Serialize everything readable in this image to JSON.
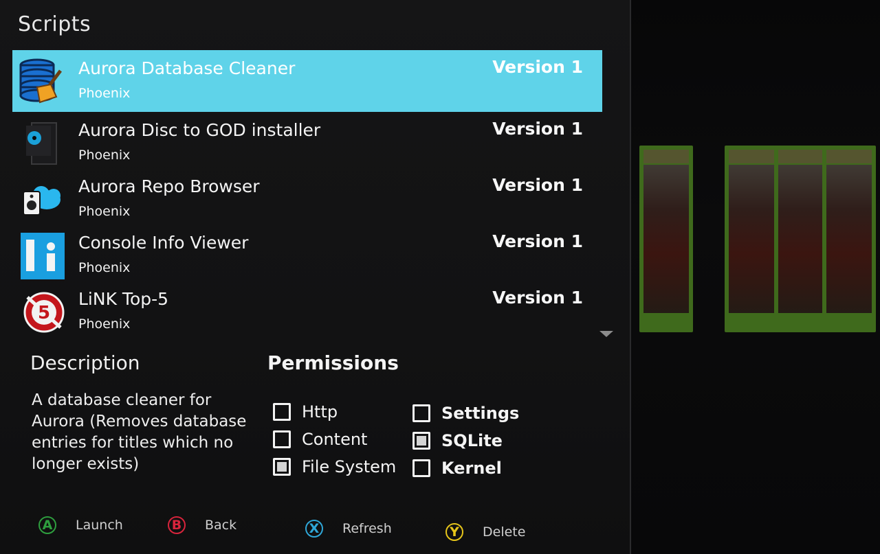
{
  "header": {
    "title": "Scripts"
  },
  "scripts": [
    {
      "name": "Aurora Database Cleaner",
      "author": "Phoenix",
      "version": "Version 1",
      "icon": "database-broom-icon",
      "selected": true
    },
    {
      "name": "Aurora Disc to GOD installer",
      "author": "Phoenix",
      "version": "Version 1",
      "icon": "disc-console-icon",
      "selected": false
    },
    {
      "name": "Aurora Repo Browser",
      "author": "Phoenix",
      "version": "Version 1",
      "icon": "cloud-speaker-icon",
      "selected": false
    },
    {
      "name": "Console Info Viewer",
      "author": "Phoenix",
      "version": "Version 1",
      "icon": "info-icon",
      "selected": false
    },
    {
      "name": "LiNK Top-5",
      "author": "Phoenix",
      "version": "Version 1",
      "icon": "link-top5-icon",
      "selected": false
    }
  ],
  "description": {
    "title": "Description",
    "text": "A database cleaner for Aurora (Removes database entries for titles which no longer exists)"
  },
  "permissions": {
    "title": "Permissions",
    "items": [
      {
        "label": "Http",
        "checked": false
      },
      {
        "label": "Content",
        "checked": false
      },
      {
        "label": "File System",
        "checked": true
      },
      {
        "label": "Settings",
        "checked": false
      },
      {
        "label": "SQLite",
        "checked": true
      },
      {
        "label": "Kernel",
        "checked": false
      }
    ]
  },
  "footer": {
    "buttons": [
      {
        "glyph": "A",
        "label": "Launch",
        "color": "#2e9e3e"
      },
      {
        "glyph": "B",
        "label": "Back",
        "color": "#d8243c"
      },
      {
        "glyph": "X",
        "label": "Refresh",
        "color": "#2fa7d8"
      },
      {
        "glyph": "Y",
        "label": "Delete",
        "color": "#e6c51a"
      }
    ]
  },
  "colors": {
    "selection": "#5fd3e9",
    "panel": "#151516"
  }
}
